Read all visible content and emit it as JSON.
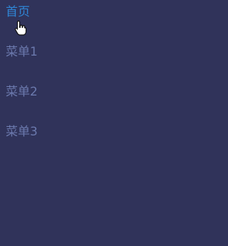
{
  "menu": {
    "items": [
      {
        "label": "首页",
        "active": true
      },
      {
        "label": "菜单1",
        "active": false
      },
      {
        "label": "菜单2",
        "active": false
      },
      {
        "label": "菜单3",
        "active": false
      }
    ]
  },
  "colors": {
    "background": "#30335a",
    "active": "#2f86d6",
    "inactive": "#6b79ad"
  },
  "icons": {
    "cursor": "hand-pointer-icon"
  }
}
